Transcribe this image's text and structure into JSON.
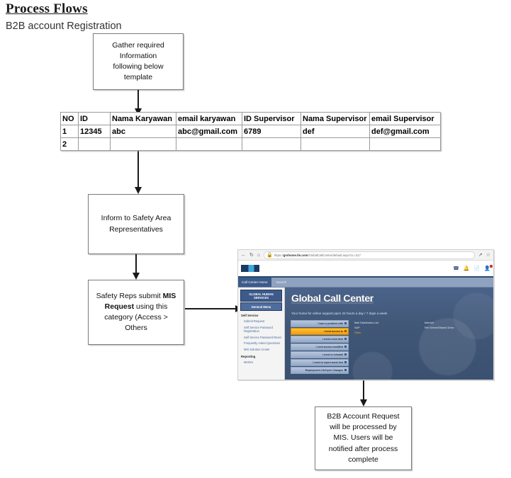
{
  "document": {
    "title": "Process Flows",
    "subtitle": "B2B account Registration"
  },
  "flow": {
    "box_gather": "Gather required\nInformation\nfollowing below\ntemplate",
    "box_inform": "Inform to Safety Area\nRepresentatives",
    "box_safety_pre": "Safety  Reps submit ",
    "box_safety_bold": "MIS\nRequest",
    "box_safety_post": " using this\ncategory (Access >\nOthers",
    "box_b2b": "B2B Account Request\nwill be processed by\nMIS. Users will be\nnotified after process\ncomplete"
  },
  "table": {
    "headers": [
      "NO",
      "ID",
      "Nama Karyawan",
      "email karyawan",
      "ID Supervisor",
      "Nama Supervisor",
      "email Supervisor"
    ],
    "rows": [
      [
        "1",
        "12345",
        "abc",
        "abc@gmail.com",
        "6789",
        "def",
        "def@gmail.com"
      ],
      [
        "2",
        "",
        "",
        "",
        "",
        "",
        ""
      ]
    ]
  },
  "browser": {
    "url_prefix": "https://",
    "url_domain": "grshome.fm.com",
    "url_path": "/GlobalCallCenter/default.aspx?cc=317",
    "back_icon": "back-arrow-icon",
    "reload_icon": "reload-icon",
    "home_icon": "home-icon",
    "lock_icon": "lock-icon",
    "share_icon": "share-icon",
    "favorite_icon": "star-icon",
    "header_icons": [
      "phone-icon",
      "bell-icon",
      "document-icon",
      "profile-icon"
    ],
    "nav": {
      "home_tab": "Call Center Home",
      "search": "Search"
    },
    "sidebar": {
      "brand": "GLOBAL HUMAN SERVICES",
      "general_menu": "General Menu",
      "sections": [
        {
          "title": "Self Service",
          "links": [
            "Submit Request",
            "Self Service Password Registration",
            "Self Service Password Reset",
            "Frequently Asked Questions",
            "MIS Solution Center"
          ]
        },
        {
          "title": "Reporting",
          "links": [
            "Metrics"
          ]
        }
      ]
    },
    "hero": {
      "title": "Global Call Center",
      "tagline": "Your home for online support,open 24 hours a day / 7 days a week"
    },
    "buttons": [
      {
        "label": "I have a problem with",
        "active": false
      },
      {
        "label": "I need access to",
        "active": true
      },
      {
        "label": "I need a new item",
        "active": false
      },
      {
        "label": "I need access modified",
        "active": false
      },
      {
        "label": "I need to reinstall",
        "active": false
      },
      {
        "label": "I need to report asset lost",
        "active": false
      },
      {
        "label": "Employment LifeCycle Changes",
        "active": false
      }
    ],
    "options": {
      "left": [
        {
          "label": "Mail Distribution List",
          "highlight": false
        },
        {
          "label": "SAP",
          "highlight": false
        },
        {
          "label": "Other",
          "highlight": true
        }
      ],
      "right": [
        {
          "label": "Internet",
          "highlight": false
        },
        {
          "label": "File Server/Shared Drive",
          "highlight": false
        }
      ]
    }
  },
  "colors": {
    "accent_blue": "#3c5a8a",
    "hero_blue": "#405777",
    "highlight_orange": "#f0a81e",
    "badge_red": "#d93025",
    "box_border": "#7a7a7a"
  }
}
